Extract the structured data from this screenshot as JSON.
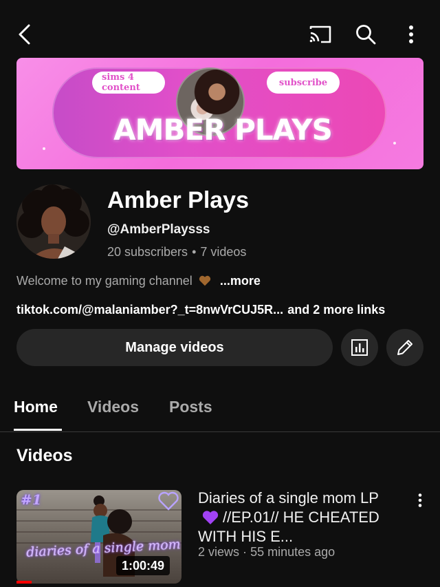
{
  "topbar": {
    "back_icon": "back-arrow-icon",
    "cast_icon": "cast-icon",
    "search_icon": "search-icon",
    "more_icon": "more-vertical-icon"
  },
  "banner": {
    "chip_left": "sims 4 content",
    "chip_right": "subscribe",
    "title": "AMBER PLAYS",
    "colors": {
      "bg": "#f46ddc",
      "pill": "#e14fc9"
    }
  },
  "channel": {
    "name": "Amber Plays",
    "handle": "@AmberPlaysss",
    "subscribers": "20 subscribers",
    "separator": "•",
    "videos": "7 videos",
    "description": "Welcome to my gaming channel",
    "description_more": "...more",
    "link": "tiktok.com/@malaniamber?_t=8nwVrCUJ5R...",
    "more_links": "and 2 more links"
  },
  "actions": {
    "manage_videos": "Manage videos",
    "analytics_icon": "analytics-icon",
    "edit_icon": "pencil-icon"
  },
  "tabs": [
    {
      "label": "Home",
      "active": true
    },
    {
      "label": "Videos",
      "active": false
    },
    {
      "label": "Posts",
      "active": false
    }
  ],
  "section": {
    "title": "Videos"
  },
  "video": {
    "thumb_number": "#1",
    "thumb_script": "diaries of a single mom",
    "duration": "1:00:49",
    "title_part1": "Diaries of a single mom LP",
    "title_part2": "//EP.01// HE CHEATED WITH HIS E...",
    "views": "2 views",
    "dot": "·",
    "age": "55 minutes ago"
  }
}
